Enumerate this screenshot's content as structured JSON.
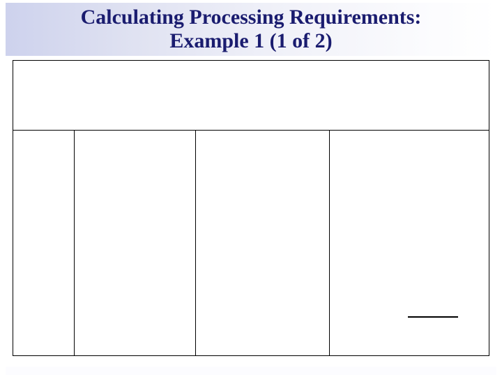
{
  "title": {
    "line1": "Calculating Processing Requirements:",
    "line2": "Example 1 (1 of 2)"
  },
  "colors": {
    "title_text": "#1a1c6f",
    "band_start": "#c8cdeb",
    "border": "#000000"
  },
  "table": {
    "header_text": "",
    "columns": [
      {
        "header": "",
        "cells": []
      },
      {
        "header": "",
        "cells": []
      },
      {
        "header": "",
        "cells": []
      },
      {
        "header": "",
        "cells": []
      }
    ]
  }
}
